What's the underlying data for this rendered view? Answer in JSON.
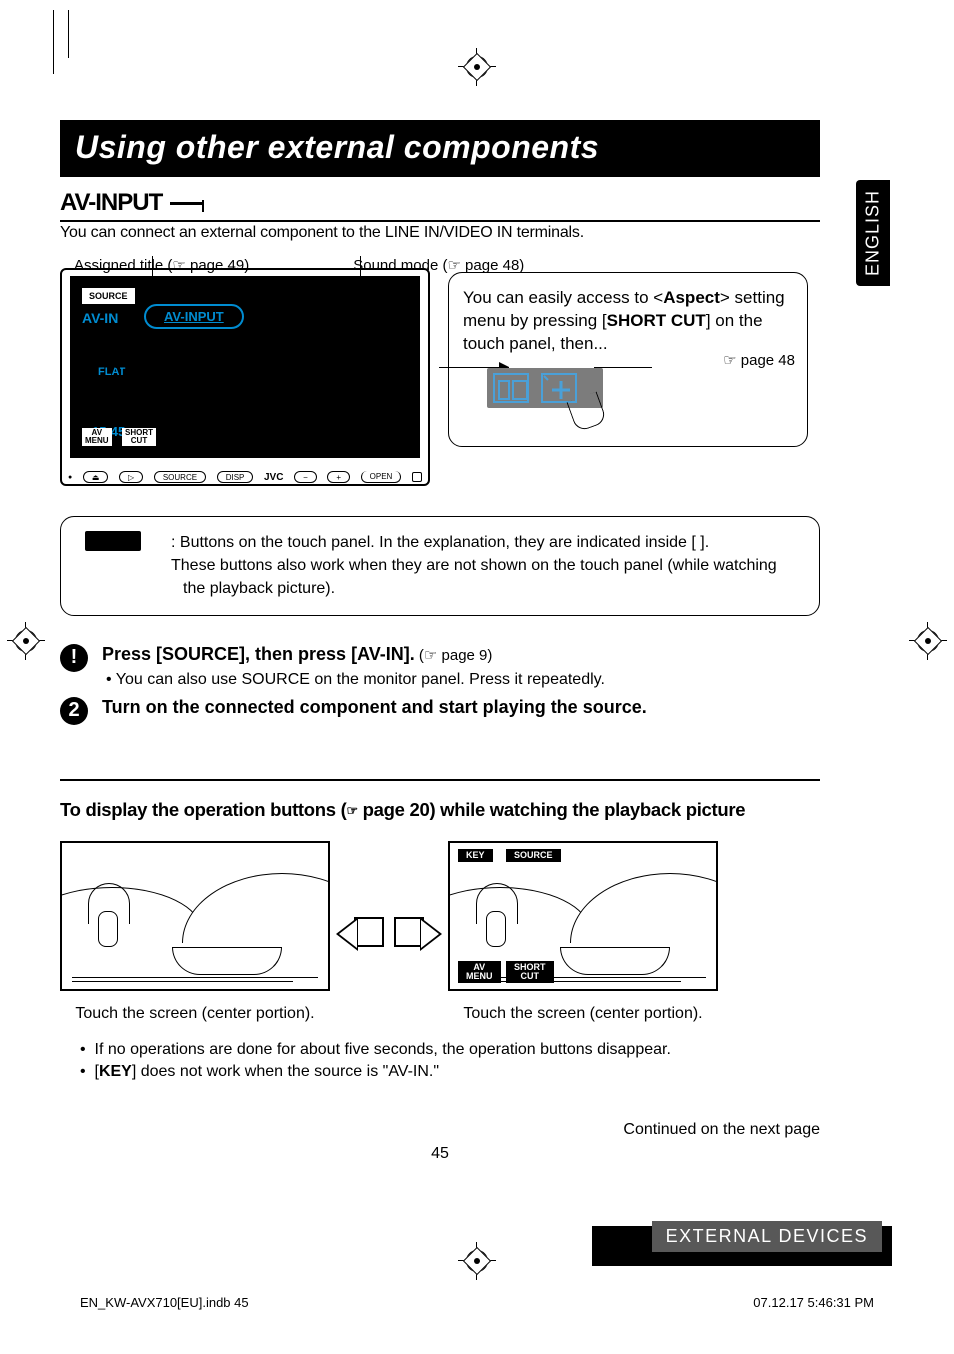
{
  "side_tab": "ENGLISH",
  "title_bar": "Using other external components",
  "h2": {
    "text": "AV-INPUT"
  },
  "intro": "You can connect an external component to the LINE IN/VIDEO IN terminals.",
  "annotations": {
    "assigned_title": "Assigned title (☞ page 49)",
    "sound_mode": "Sound mode (☞ page 48)"
  },
  "device": {
    "btn_source": "SOURCE",
    "lbl_avin": "AV-IN",
    "rounded_title": "AV-INPUT",
    "lbl_flat": "FLAT",
    "lbl_time": "15:45",
    "btn_avmenu": "AV\nMENU",
    "btn_short": "SHORT\nCUT",
    "controls": {
      "source": "SOURCE",
      "disp": "DISP",
      "brand": "JVC",
      "minus": "−",
      "plus": "+",
      "open": "OPEN"
    }
  },
  "callout": {
    "text_pre": "You can easily access to <",
    "aspect": "Aspect",
    "text_mid": "> setting menu by pressing [",
    "shortcut": "SHORT CUT",
    "text_post": "] on the touch panel, then...",
    "page_ref": "☞ page 48"
  },
  "note_box": {
    "line1_pre": ":   Buttons on the touch panel. In the explanation, they are indicated inside [      ].",
    "line2": "These buttons also work when they are not shown on the touch panel (while watching the playback picture)."
  },
  "steps": [
    {
      "bold": "Press [SOURCE], then press [AV-IN].",
      "ref": " (☞ page 9)",
      "sub": "•  You can also use SOURCE on the monitor panel. Press it repeatedly."
    },
    {
      "bold": "Turn on the connected component and start playing the source."
    }
  ],
  "subtitle": {
    "pre": "To display the operation buttons (",
    "icon": "☞",
    "post": " page 20) while watching the playback picture"
  },
  "pic_labels": {
    "key": "KEY",
    "source": "SOURCE",
    "avmenu": "AV\nMENU",
    "shortcut": "SHORT\nCUT"
  },
  "captions": {
    "left": "Touch the screen (center portion).",
    "right": "Touch the screen (center portion)."
  },
  "bullets": [
    "If no operations are done for about five seconds, the operation buttons disappear.",
    "[KEY] does not work when the source is \"AV-IN.\""
  ],
  "bullet_bold": "KEY",
  "continued": "Continued on the next page",
  "page_num": "45",
  "section_label": "EXTERNAL DEVICES",
  "footer": {
    "left": "EN_KW-AVX710[EU].indb   45",
    "right": "07.12.17   5:46:31 PM"
  }
}
